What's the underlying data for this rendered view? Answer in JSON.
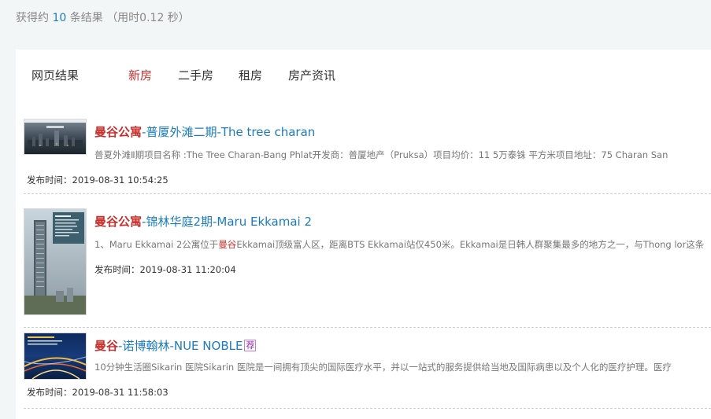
{
  "stats": {
    "prefix": "获得约",
    "count": "10",
    "suffix": "条结果",
    "time": "（用时0.12 秒）"
  },
  "tabs": [
    {
      "label": "网页结果",
      "active": false
    },
    {
      "label": "新房",
      "active": true
    },
    {
      "label": "二手房",
      "active": false
    },
    {
      "label": "租房",
      "active": false
    },
    {
      "label": "房产资讯",
      "active": false
    }
  ],
  "results": [
    {
      "title_kw": "曼谷公寓",
      "title_sep": "-",
      "title_rest": "普厦外滩二期-The tree charan",
      "snippet": "普夏外滩Ⅱ期项目名称 :The Tree Charan-Bang Phlat开发商：普厦地产（Pruksa）项目均价：11 5万泰铢 平方米项目地址：75 Charan San",
      "date": "发布时间：2019-08-31 10:54:25"
    },
    {
      "title_kw": "曼谷公寓",
      "title_sep": "-",
      "title_rest": "锦林华庭2期-Maru Ekkamai 2",
      "snippet_before": "1、Maru Ekkamai 2公寓位于",
      "snippet_hl": "曼谷",
      "snippet_after": "Ekkamai顶级富人区，距离BTS Ekkamai站仅450米。Ekkamai是日韩人群聚集最多的地方之一，与Thong lor这条",
      "date": "发布时间：2019-08-31 11:20:04"
    },
    {
      "title_kw": "曼谷",
      "title_sep": "-",
      "title_rest": "诺博翰林-NUE NOBLE",
      "badge": "荐",
      "snippet": "10分钟生活圈Sikarin 医院Sikarin 医院是一间拥有顶尖的国际医疗水平，并以一站式的服务提供给当地及国际病患以及个人化的医疗护理。医疗",
      "date": "发布时间：2019-08-31 11:58:03"
    }
  ],
  "colors": {
    "accent_red": "#c8312d",
    "link_blue": "#1a7cc0",
    "badge_purple": "#a020b8"
  }
}
